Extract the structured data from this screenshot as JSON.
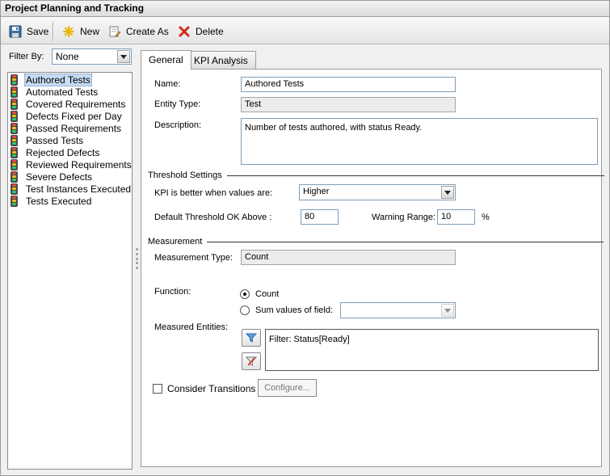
{
  "window": {
    "title": "Project Planning and Tracking"
  },
  "toolbar": {
    "save_label": "Save",
    "new_label": "New",
    "create_as_label": "Create As",
    "delete_label": "Delete"
  },
  "filter": {
    "label": "Filter By:",
    "value": "None"
  },
  "kpi_list": {
    "items": [
      {
        "label": "Authored Tests",
        "selected": true
      },
      {
        "label": "Automated Tests"
      },
      {
        "label": "Covered Requirements"
      },
      {
        "label": "Defects Fixed per Day"
      },
      {
        "label": "Passed Requirements"
      },
      {
        "label": "Passed Tests"
      },
      {
        "label": "Rejected Defects"
      },
      {
        "label": "Reviewed Requirements"
      },
      {
        "label": "Severe Defects"
      },
      {
        "label": "Test Instances Executed"
      },
      {
        "label": "Tests Executed"
      }
    ]
  },
  "tabs": [
    {
      "label": "General",
      "active": true
    },
    {
      "label": "KPI Analysis"
    }
  ],
  "general": {
    "name_label": "Name:",
    "name_value": "Authored Tests",
    "entity_type_label": "Entity Type:",
    "entity_type_value": "Test",
    "description_label": "Description:",
    "description_value": "Number of tests authored, with status Ready.",
    "threshold": {
      "section_label": "Threshold Settings",
      "better_label": "KPI is better when values are:",
      "better_value": "Higher",
      "ok_above_label": "Default Threshold OK Above :",
      "ok_above_value": "80",
      "warning_label": "Warning Range:",
      "warning_value": "10",
      "percent_label": "%"
    },
    "measurement": {
      "section_label": "Measurement",
      "type_label": "Measurement Type:",
      "type_value": "Count",
      "function_label": "Function:",
      "count_option": "Count",
      "sum_option": "Sum values of field:",
      "sum_field_value": "",
      "measured_entities_label": "Measured Entities:",
      "filter_text": "Filter: Status[Ready]"
    },
    "consider_transitions_label": "Consider Transitions",
    "configure_label": "Configure..."
  },
  "colors": {
    "selection": "#c5dcf5",
    "delete_icon": "#d42a1a",
    "new_icon": "#e8b400",
    "filter_icon": "#2e6fb7"
  }
}
